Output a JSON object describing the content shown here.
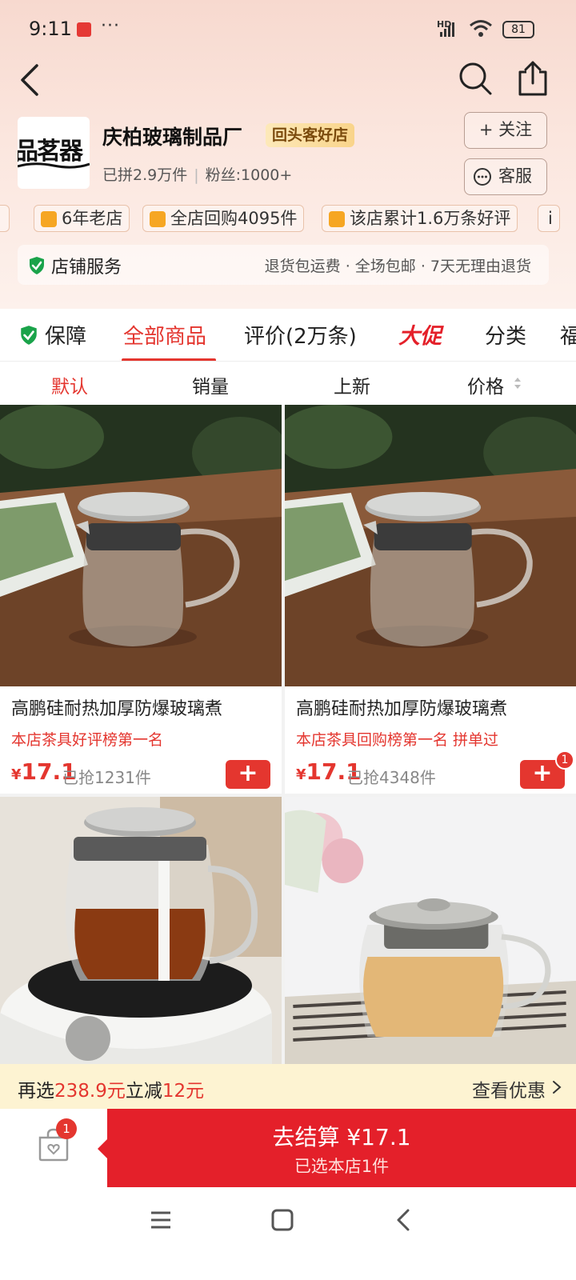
{
  "status_bar": {
    "time": "9:11",
    "dots": "···",
    "hd": "HD",
    "battery": "81"
  },
  "shop": {
    "logo_text": "品茗器",
    "name": "庆柏玻璃制品厂",
    "badge": "回头客好店",
    "sold": "已拼2.9万件",
    "fans": "粉丝:1000+",
    "follow_label": "+ 关注",
    "service_label": "客服"
  },
  "tags": [
    {
      "label": "6年老店",
      "icon": "store-icon",
      "color": "#f6a623"
    },
    {
      "label": "全店回购4095件",
      "icon": "cart-icon",
      "color": "#f6a623"
    },
    {
      "label": "该店累计1.6万条好评",
      "icon": "thumbs-up-icon",
      "color": "#f6a623"
    },
    {
      "label": "i",
      "icon": "info-icon",
      "color": "#f6a623"
    }
  ],
  "store_service": {
    "title": "店铺服务",
    "desc": "退货包运费 · 全场包邮 · 7天无理由退货"
  },
  "tabs": {
    "guarantee": "保障",
    "all": "全部商品",
    "reviews": "评价(2万条)",
    "promo": "大促",
    "category": "分类",
    "more": "福"
  },
  "sort": {
    "default": "默认",
    "sales": "销量",
    "new": "上新",
    "price": "价格"
  },
  "products": [
    {
      "title": "高鹏硅耐热加厚防爆玻璃煮",
      "sub": "本店茶具好评榜第一名",
      "currency": "¥",
      "price": "17.1",
      "sold": "已抢1231件",
      "badge": ""
    },
    {
      "title": "高鹏硅耐热加厚防爆玻璃煮",
      "sub": "本店茶具回购榜第一名  拼单过",
      "currency": "¥",
      "price": "17.1",
      "sold": "已抢4348件",
      "badge": "1"
    }
  ],
  "promo_bar": {
    "prefix": "再选",
    "amount": "238.9元",
    "mid": "立减",
    "discount": "12元",
    "link": "查看优惠"
  },
  "checkout": {
    "cart_badge": "1",
    "main": "去结算 ¥17.1",
    "sub": "已选本店1件"
  },
  "colors": {
    "accent": "#e4362f",
    "checkout": "#e4202a",
    "promo_bg": "#fdf3d2"
  }
}
